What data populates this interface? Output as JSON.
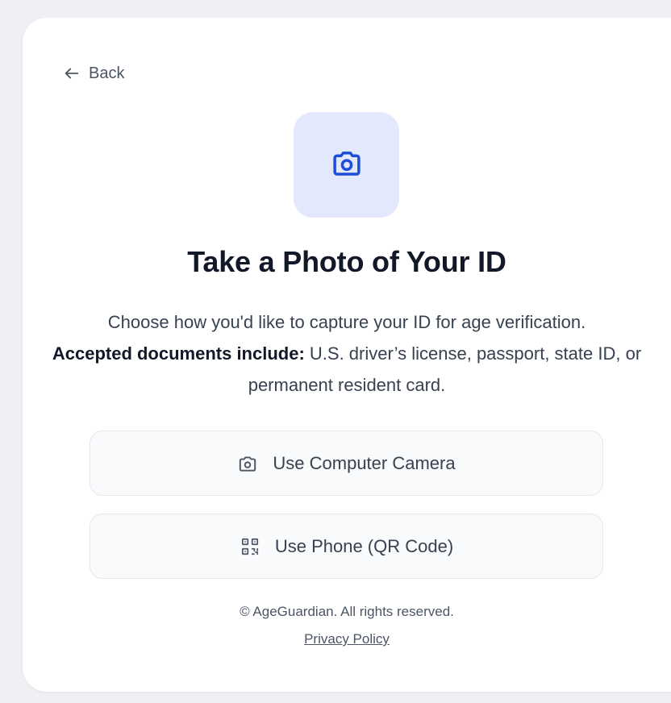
{
  "nav": {
    "back_label": "Back"
  },
  "hero": {
    "icon": "camera-icon",
    "title": "Take a Photo of Your ID"
  },
  "description": {
    "line1": "Choose how you'd like to capture your ID for age verification.",
    "accepted_label": "Accepted documents include:",
    "accepted_list": " U.S. driver’s license, passport, state ID, or permanent resident card."
  },
  "options": [
    {
      "label": "Use Computer Camera",
      "icon": "camera-icon"
    },
    {
      "label": "Use Phone (QR Code)",
      "icon": "qr-code-icon"
    }
  ],
  "footer": {
    "copyright": "© AgeGuardian. All rights reserved.",
    "privacy_label": "Privacy Policy"
  },
  "colors": {
    "accent": "#1d4ed8",
    "tile_bg": "#e3e8fd",
    "title": "#111827",
    "body": "#374151"
  }
}
